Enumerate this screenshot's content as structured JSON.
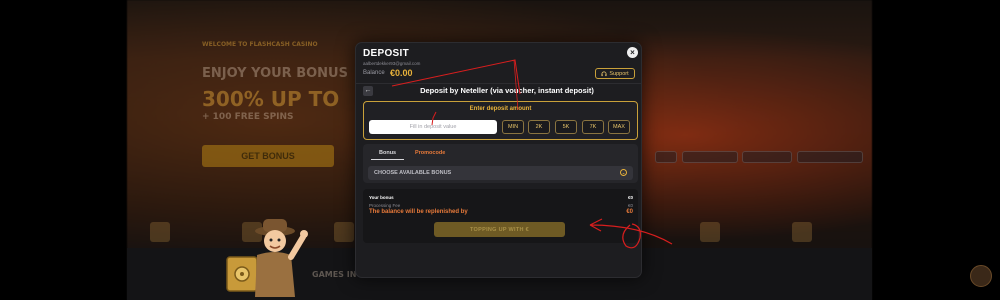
{
  "background": {
    "welcome_text": "WELCOME TO FLASHCASH CASINO",
    "headline": "ENJOY YOUR BONUS",
    "offer": "300% UP TO",
    "spins": "+ 100 FREE SPINS",
    "cta": "GET BONUS",
    "games_text": "GAMES IN THE"
  },
  "modal": {
    "title": "DEPOSIT",
    "email": "aalbertdekker93@gmail.com",
    "balance_label": "Balance",
    "balance_value": "€0.00",
    "support_label": "Support",
    "close_icon": "×",
    "back_icon": "←",
    "method_title": "Deposit by Neteller (via voucher, instant deposit)",
    "amount": {
      "title": "Enter deposit amount",
      "placeholder": "Fill in deposit value",
      "quick_buttons": [
        "MIN",
        "2K",
        "5K",
        "7K",
        "MAX"
      ]
    },
    "bonus": {
      "tabs": [
        "Bonus",
        "Promocode"
      ],
      "select_label": "CHOOSE AVAILABLE BONUS"
    },
    "summary": {
      "your_bonus_label": "Your bonus",
      "your_bonus_value": "€0",
      "fee_label": "Processing Fee",
      "fee_value": "€0",
      "replenish_label": "The balance will be replenished by",
      "replenish_value": "€0",
      "topup_label": "TOPPING UP WITH €"
    }
  },
  "colors": {
    "accent_gold": "#e8b23a",
    "accent_orange": "#e87a3a",
    "annotation_red": "#d81e1e"
  }
}
